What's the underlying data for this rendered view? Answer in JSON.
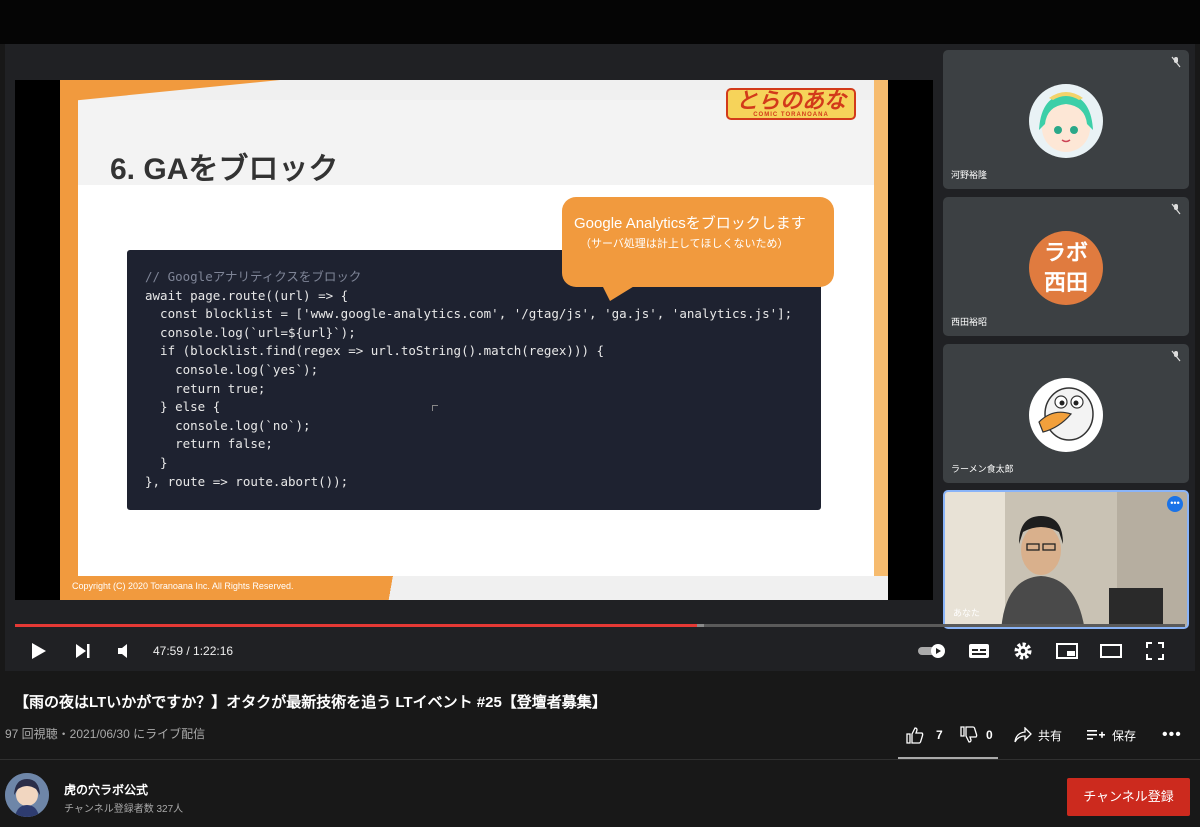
{
  "slide": {
    "title": "6. GAをブロック",
    "logo_text": "とらのあな",
    "logo_sub": "COMIC TORANOANA",
    "bubble_line1": "Google Analyticsをブロックします",
    "bubble_line2": "（サーバ処理は計上してほしくないため）",
    "code_lines": [
      "// Googleアナリティクスをブロック",
      "await page.route((url) => {",
      "  const blocklist = ['www.google-analytics.com', '/gtag/js', 'ga.js', 'analytics.js'];",
      "  console.log(`url=${url}`);",
      "  if (blocklist.find(regex => url.toString().match(regex))) {",
      "    console.log(`yes`);",
      "    return true;",
      "  } else {",
      "    console.log(`no`);",
      "    return false;",
      "  }",
      "}, route => route.abort());"
    ],
    "copyright": "Copyright (C) 2020 Toranoana Inc. All Rights Reserved."
  },
  "participants": [
    {
      "name": "河野裕隆",
      "icon": "anime-girl-avatar"
    },
    {
      "name": "西田裕昭",
      "avatar_text_1": "ラボ",
      "avatar_text_2": "西田"
    },
    {
      "name": "ラーメン食太郎",
      "icon": "duck-avatar"
    },
    {
      "name": "あなた",
      "icon": "camera-feed"
    }
  ],
  "player": {
    "time": "47:59 / 1:22:16",
    "progress_fraction": 0.583,
    "buffer_fraction": 0.589,
    "progress_color": "#e53935"
  },
  "video": {
    "title": "【雨の夜はLTいかがですか？】オタクが最新技術を追う LTイベント #25【登壇者募集】",
    "meta": "97 回視聴・2021/06/30 にライブ配信",
    "likes": "7",
    "dislikes": "0",
    "share": "共有",
    "save": "保存"
  },
  "channel": {
    "name": "虎の穴ラボ公式",
    "subs": "チャンネル登録者数 327人",
    "subscribe": "チャンネル登録"
  }
}
